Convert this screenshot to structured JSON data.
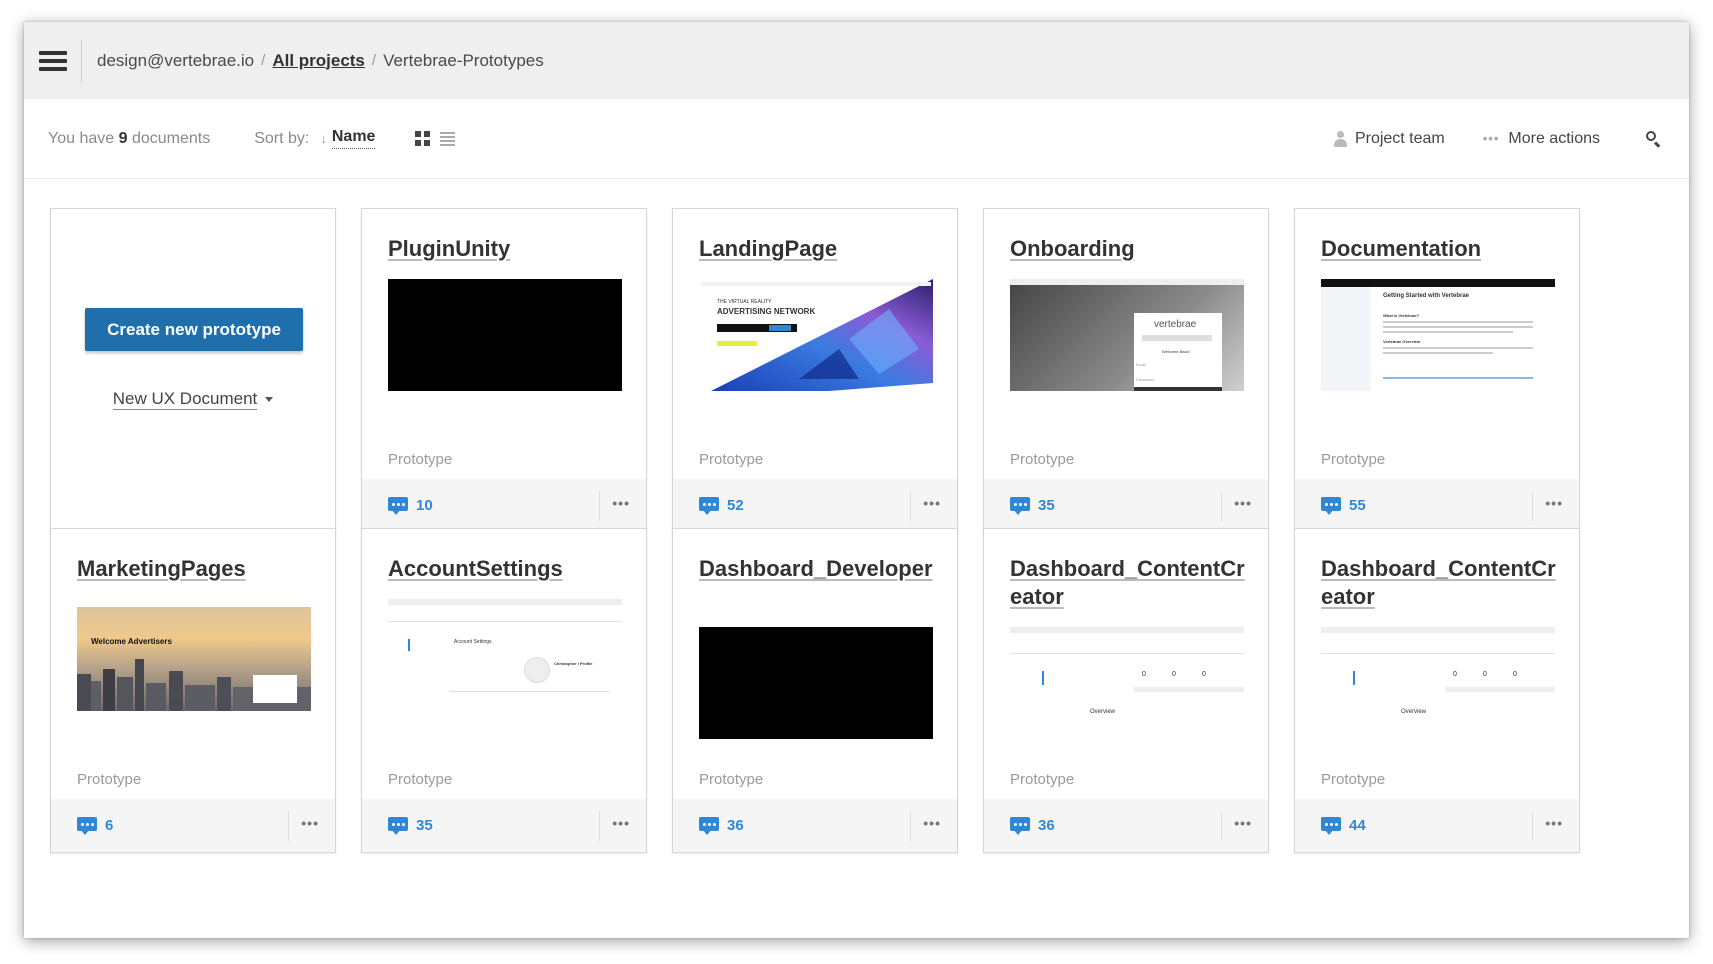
{
  "header": {
    "account": "design@vertebrae.io",
    "separator": "/",
    "breadcrumb_link": "All projects",
    "current_project": "Vertebrae-Prototypes"
  },
  "toolbar": {
    "count_prefix": "You have",
    "count_value": "9",
    "count_suffix": "documents",
    "sort_label": "Sort by:",
    "sort_value": "Name",
    "project_team": "Project team",
    "more_actions": "More actions"
  },
  "create_card": {
    "button_label": "Create new prototype",
    "new_doc_label": "New UX Document"
  },
  "cards": [
    {
      "title": "PluginUnity",
      "type": "Prototype",
      "comments": "10"
    },
    {
      "title": "LandingPage",
      "type": "Prototype",
      "comments": "52"
    },
    {
      "title": "Onboarding",
      "type": "Prototype",
      "comments": "35"
    },
    {
      "title": "Documentation",
      "type": "Prototype",
      "comments": "55"
    },
    {
      "title": "MarketingPages",
      "type": "Prototype",
      "comments": "6"
    },
    {
      "title": "AccountSettings",
      "type": "Prototype",
      "comments": "35"
    },
    {
      "title": "Dashboard_Developer",
      "type": "Prototype",
      "comments": "36"
    },
    {
      "title": "Dashboard_ContentCreator",
      "type": "Prototype",
      "comments": "36"
    },
    {
      "title": "Dashboard_ContentCreator",
      "type": "Prototype",
      "comments": "44"
    }
  ],
  "thumb_text": {
    "landing_tag": "THE VIRTUAL REALITY",
    "landing_head": "ADVERTISING NETWORK",
    "onboarding_logo": "vertebrae",
    "onboarding_welcome": "Welcome Back!",
    "onboarding_email": "Email",
    "onboarding_password": "Password",
    "doc_heading": "Getting Started with Vertebrae",
    "doc_sub": "What is Vertebrae?",
    "doc_overview": "Vertebrae Overview",
    "marketing_head": "Welcome Advertisers",
    "account_title": "Account Settings",
    "account_name": "Christopher / Profile",
    "dash_overview": "Overview",
    "dash_zero": "0"
  },
  "colors": {
    "accent": "#2f87d6",
    "primary_button": "#1f6fad",
    "header_bg": "#efefef"
  }
}
